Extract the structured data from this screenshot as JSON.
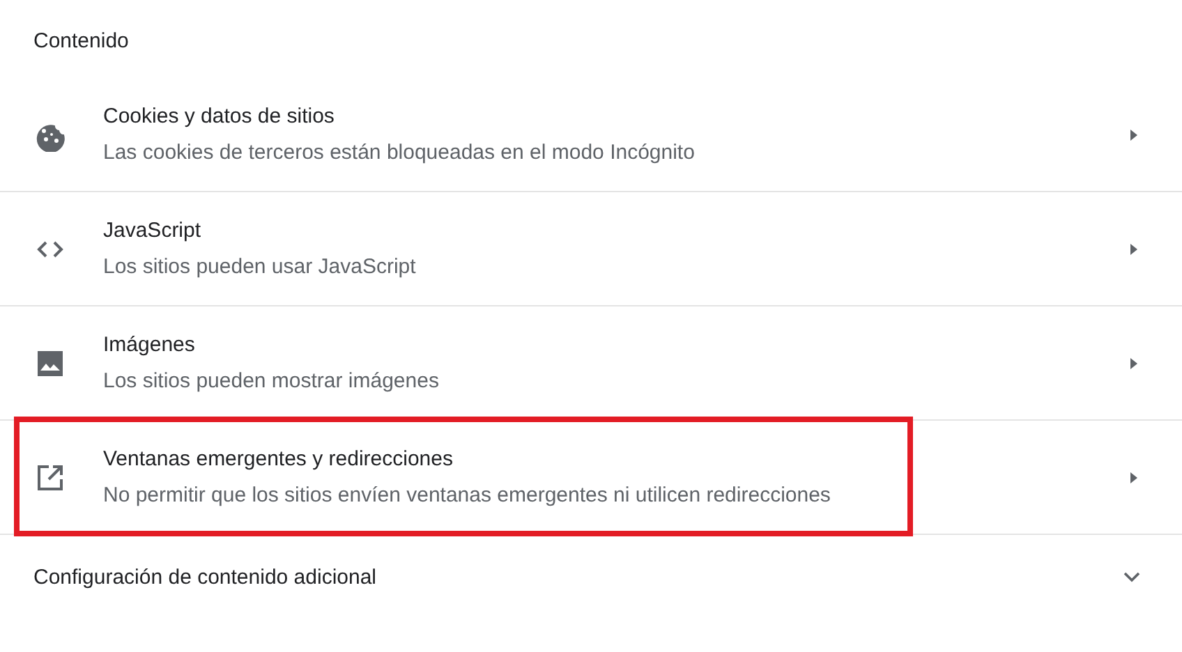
{
  "section_title": "Contenido",
  "items": [
    {
      "kind": "cookie",
      "title": "Cookies y datos de sitios",
      "subtitle": "Las cookies de terceros están bloqueadas en el modo Incógnito",
      "highlighted": false
    },
    {
      "kind": "code",
      "title": "JavaScript",
      "subtitle": "Los sitios pueden usar JavaScript",
      "highlighted": false
    },
    {
      "kind": "image",
      "title": "Imágenes",
      "subtitle": "Los sitios pueden mostrar imágenes",
      "highlighted": false
    },
    {
      "kind": "open",
      "title": "Ventanas emergentes y redirecciones",
      "subtitle": "No permitir que los sitios envíen ventanas emergentes ni utilicen redirecciones",
      "highlighted": true
    }
  ],
  "additional": {
    "label": "Configuración de contenido adicional",
    "expanded": false
  }
}
